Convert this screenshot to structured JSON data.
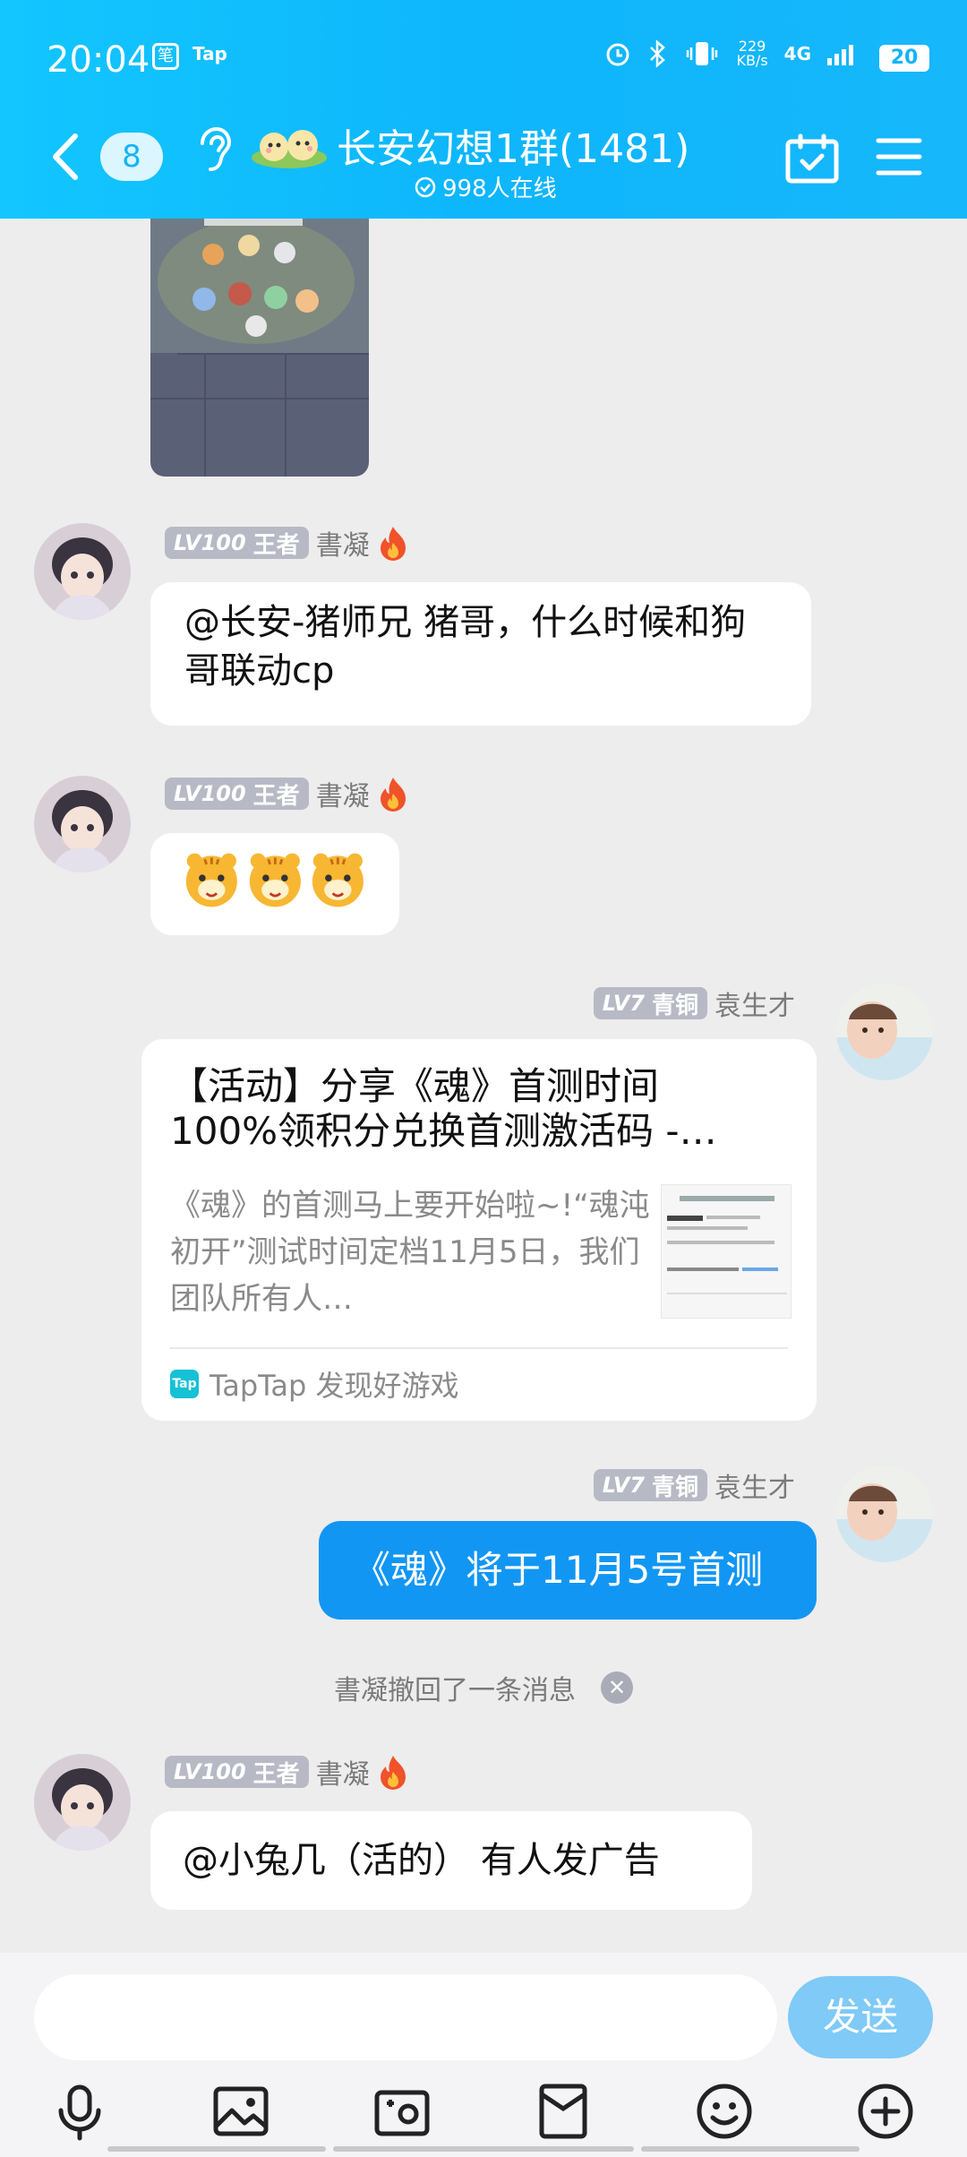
{
  "status_bar": {
    "time": "20:04",
    "app_icon_1": "笔",
    "app_icon_2": "Tap",
    "net_speed_value": "229",
    "net_speed_unit": "KB/s",
    "network": "4G",
    "battery": "20"
  },
  "header": {
    "unread_count": "8",
    "group_title": "长安幻想1群(1481)",
    "online_text": "998人在线",
    "icons": [
      "back-arrow-icon",
      "ear-icon",
      "calendar-check-icon",
      "menu-icon"
    ]
  },
  "messages": [
    {
      "type": "text",
      "level": "LV100",
      "rank": "王者",
      "nickname": "書凝",
      "text": "@长安-猪师兄 猪哥，什么时候和狗哥联动cp"
    },
    {
      "type": "emoji",
      "level": "LV100",
      "rank": "王者",
      "nickname": "書凝",
      "emojis": [
        "tiger-emoji",
        "tiger-emoji",
        "tiger-emoji"
      ]
    },
    {
      "type": "link_card",
      "level": "LV7",
      "rank": "青铜",
      "nickname": "袁生才",
      "card_title": "【活动】分享《魂》首测时间100%领积分兑换首测激活码 -…",
      "card_desc": "《魂》的首测马上要开始啦~!“魂沌初开”测试时间定档11月5日，我们团队所有人…",
      "card_source": "TapTap 发现好游戏",
      "card_source_icon": "Tap"
    },
    {
      "type": "text",
      "level": "LV7",
      "rank": "青铜",
      "nickname": "袁生才",
      "text": "《魂》将于11月5号首测"
    },
    {
      "type": "text",
      "level": "LV100",
      "rank": "王者",
      "nickname": "書凝",
      "text": "@小兔几（活的） 有人发广告"
    }
  ],
  "recall_notice": "書凝撤回了一条消息",
  "input": {
    "placeholder": "",
    "send_label": "发送"
  },
  "toolbar_icons": [
    "microphone-icon",
    "image-icon",
    "camera-icon",
    "red-packet-icon",
    "emoji-icon",
    "plus-icon"
  ],
  "colors": {
    "header": "#13c6ff",
    "bubble_self": "#1296f3",
    "send_button": "#7fcaf7",
    "background": "#ededed"
  }
}
